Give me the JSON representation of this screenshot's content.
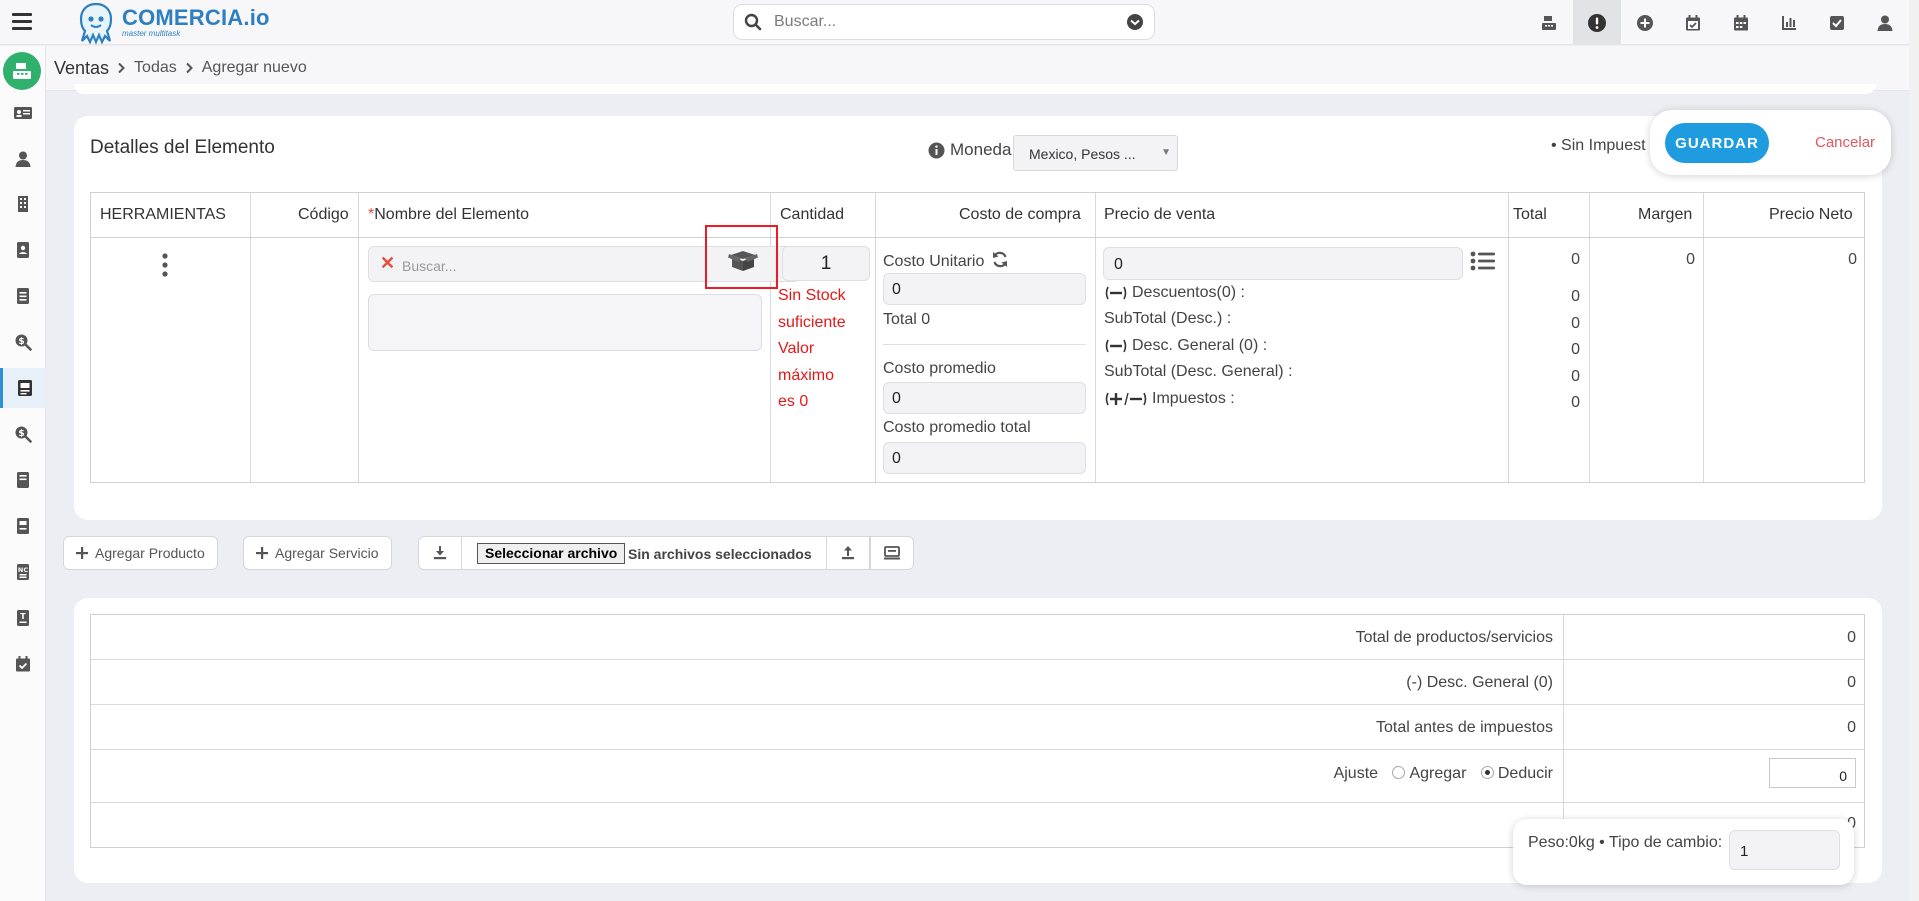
{
  "app": {
    "brand_name": "COMERCIA.io",
    "brand_tagline": "master multitask",
    "search_placeholder": "Buscar..."
  },
  "breadcrumb": {
    "main": "Ventas",
    "level1": "Todas",
    "level2": "Agregar nuevo"
  },
  "top_icons": [
    "cash-register-icon",
    "alert-icon",
    "plus-circle-icon",
    "calendar-check-icon",
    "calendar-icon",
    "bar-chart-icon",
    "checkbox-icon",
    "user-icon"
  ],
  "details": {
    "title": "Detalles del Elemento",
    "moneda_label": "Moneda",
    "moneda_value": "Mexico, Pesos ...",
    "sin_impuestos": "• Sin Impuest",
    "save_label": "GUARDAR",
    "cancel_label": "Cancelar"
  },
  "table": {
    "headers": {
      "tools": "HERRAMIENTAS",
      "code": "Código",
      "name_req": "*",
      "name": "Nombre del Elemento",
      "qty": "Cantidad",
      "cost": "Costo de compra",
      "price": "Precio de venta",
      "total": "Total",
      "margin": "Margen",
      "net": "Precio Neto"
    },
    "row": {
      "name_placeholder": "Buscar...",
      "quantity": "1",
      "stock_warning": "Sin Stock\nsuficiente\nValor\nmáximo\nes 0",
      "costo_unitario_label": "Costo Unitario",
      "costo_unitario": "0",
      "total_cost": "Total 0",
      "costo_promedio_label": "Costo promedio",
      "costo_promedio": "0",
      "costo_promedio_total_label": "Costo promedio total",
      "costo_promedio_total": "0",
      "precio_venta": "0",
      "descuentos": "Descuentos(0) :",
      "subtotal_desc": "SubTotal (Desc.) :",
      "desc_general": "Desc. General (0) :",
      "subtotal_desc_general": "SubTotal (Desc. General) :",
      "impuestos": "Impuestos :",
      "total": "0",
      "margin": "0",
      "net": "0",
      "price_breakdown": [
        "0",
        "0",
        "0",
        "0",
        "0"
      ]
    }
  },
  "actions": {
    "add_product": "Agregar Producto",
    "add_service": "Agregar Servicio",
    "file_button": "Seleccionar archivo",
    "no_files": "Sin archivos seleccionados"
  },
  "totals": {
    "total_items_label": "Total de productos/servicios",
    "total_items": "0",
    "desc_general_label": "(-) Desc. General (0)",
    "desc_general": "0",
    "before_tax_label": "Total antes de impuestos",
    "before_tax": "0",
    "ajuste_label": "Ajuste",
    "ajuste_add": "Agregar",
    "ajuste_deduct": "Deducir",
    "ajuste_value": "0",
    "last_row_value": "0"
  },
  "footer": {
    "peso_text": "Peso:0kg • Tipo de cambio:",
    "tipo_cambio": "1"
  },
  "colors": {
    "accent": "#1f9be0",
    "brand": "#2d7fc1",
    "danger": "#e31919",
    "app_badge": "#2fb06c"
  }
}
